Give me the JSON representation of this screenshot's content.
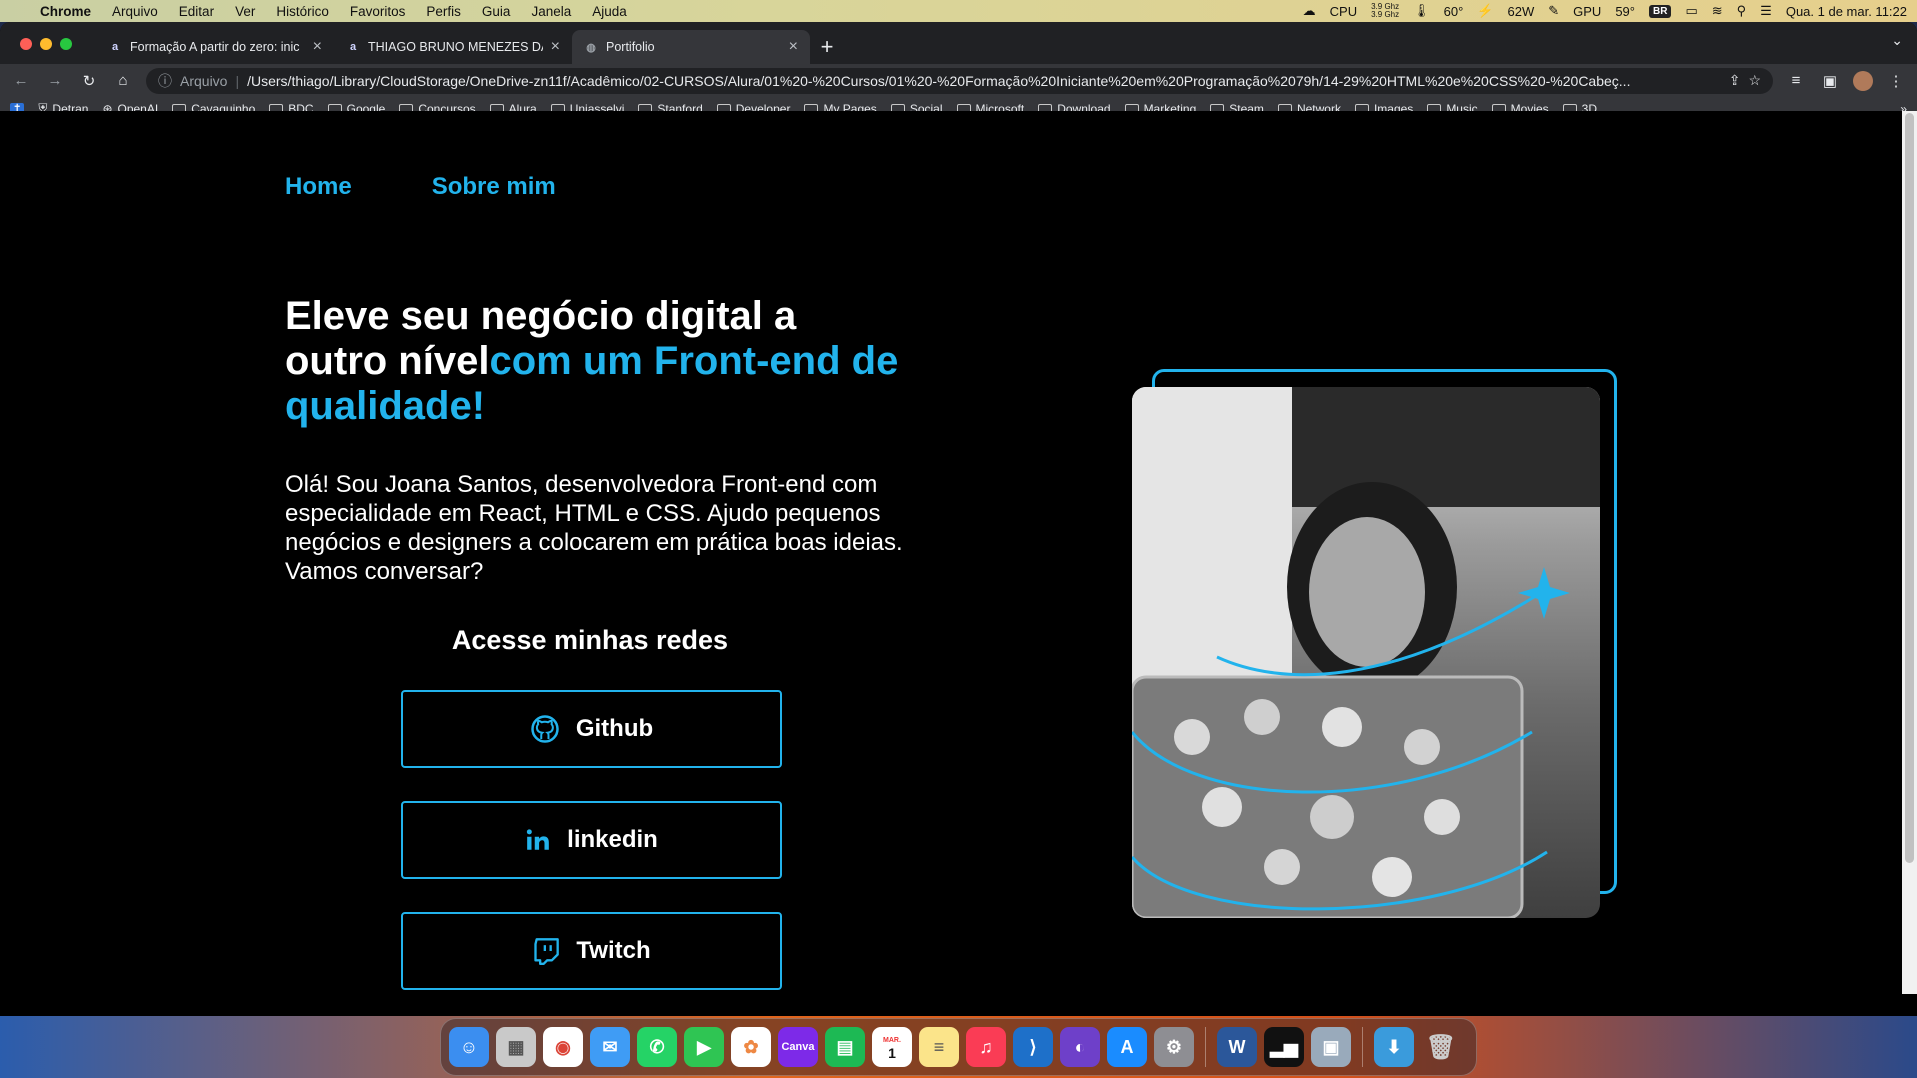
{
  "menubar": {
    "app": "Chrome",
    "items": [
      "Arquivo",
      "Editar",
      "Ver",
      "Histórico",
      "Favoritos",
      "Perfis",
      "Guia",
      "Janela",
      "Ajuda"
    ],
    "cpu_label": "CPU",
    "cpu_freq_1": "3.9 Ghz",
    "cpu_freq_2": "3.9 Ghz",
    "cpu_temp": "60°",
    "power": "62W",
    "gpu_label": "GPU",
    "gpu_temp": "59°",
    "input_source": "BR",
    "datetime": "Qua. 1 de mar.  11:22"
  },
  "tabs": [
    {
      "title": "Formação A partir do zero: inic",
      "favicon": "a"
    },
    {
      "title": "THIAGO BRUNO MENEZES DA",
      "favicon": "a"
    },
    {
      "title": "Portifolio",
      "favicon": "globe-icon"
    }
  ],
  "omnibox": {
    "label": "Arquivo",
    "url": "/Users/thiago/Library/CloudStorage/OneDrive-zn11f/Acadêmico/02-CURSOS/Alura/01%20-%20Cursos/01%20-%20Formação%20Iniciante%20em%20Programação%2079h/14-29%20HTML%20e%20CSS%20-%20Cabeç..."
  },
  "bookmarks": [
    "Detran",
    "OpenAI",
    "Cavaquinho",
    "BDC",
    "Google",
    "Concursos",
    "Alura",
    "Uniasselvi",
    "Stanford",
    "Developer",
    "My Pages",
    "Social",
    "Microsoft",
    "Download",
    "Marketing",
    "Steam",
    "Network",
    "Images",
    "Music",
    "Movies",
    "3D"
  ],
  "page": {
    "nav": {
      "home": "Home",
      "about": "Sobre mim"
    },
    "headline_white": "Eleve seu negócio digital a outro nível",
    "headline_accent": "com um Front-end de qualidade!",
    "intro": "Olá! Sou Joana Santos, desenvolvedora Front-end com especialidade em React, HTML e CSS. Ajudo pequenos negócios e designers a colocarem em prática boas ideias. Vamos conversar?",
    "social_title": "Acesse minhas redes",
    "social": [
      {
        "label": "Github",
        "icon": "github-icon"
      },
      {
        "label": "linkedin",
        "icon": "linkedin-icon"
      },
      {
        "label": "Twitch",
        "icon": "twitch-icon"
      }
    ],
    "photo_alt": "Joana Santos"
  },
  "dock": [
    "Finder",
    "Launchpad",
    "Chrome",
    "Mail",
    "WhatsApp",
    "FaceTime",
    "Photos",
    "Canva",
    "Numbers",
    "Calendar",
    "Notes",
    "Music",
    "VS Code",
    "GitHub Desktop",
    "App Store",
    "System Settings",
    "Word",
    "Activity Monitor",
    "Preview",
    "Downloads",
    "Trash"
  ],
  "dock_calendar": {
    "month": "MAR.",
    "day": "1"
  },
  "colors": {
    "accent": "#22b3ec",
    "background": "#000000"
  }
}
